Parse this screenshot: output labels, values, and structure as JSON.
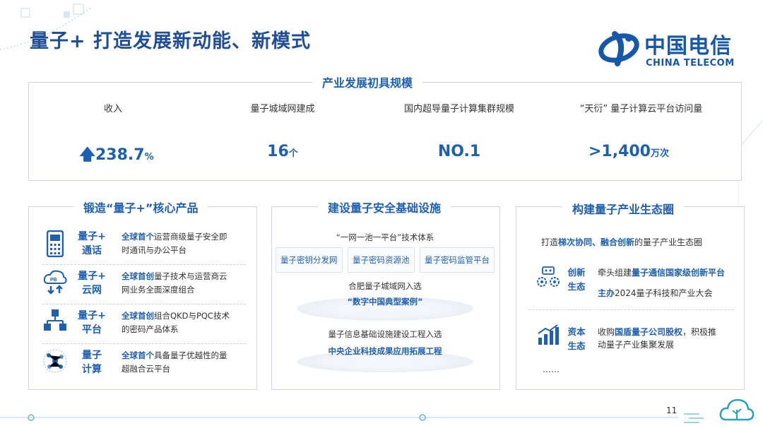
{
  "title": "量子+ 打造发展新动能、新模式",
  "logo": {
    "cn": "中国电信",
    "en": "CHINA TELECOM"
  },
  "scale": {
    "title": "产业发展初具规模",
    "stats": [
      {
        "label": "收入",
        "value": "238.7",
        "unit": "%"
      },
      {
        "label": "量子城域网建成",
        "value": "16",
        "unit": "个"
      },
      {
        "label": "国内超导量子计算集群规模",
        "value": "NO.1",
        "unit": ""
      },
      {
        "label": "“天衍” 量子计算云平台访问量",
        "value": ">1,400",
        "unit": "万次"
      }
    ]
  },
  "products": {
    "title": "锻造“量子+”核心产品",
    "items": [
      {
        "name1": "量子+",
        "name2": "通话",
        "hl": "全球首个",
        "desc1": "运营商级量子安全即",
        "desc2": "时通讯与办公平台"
      },
      {
        "name1": "量子+",
        "name2": "云网",
        "hl": "全球首创",
        "desc1": "量子技术与运营商云",
        "desc2": "网业务全面深度组合"
      },
      {
        "name1": "量子+",
        "name2": "平台",
        "hl": "全球首创",
        "desc1": "组合QKD与PQC技术",
        "desc2": "的密码产品体系"
      },
      {
        "name1": "量子",
        "name2": "计算",
        "hl": "全球首个",
        "desc1": "具备量子优越性的量",
        "desc2": "超融合云平台"
      }
    ]
  },
  "infra": {
    "title": "建设量子安全基础设施",
    "system": "“一网一池一平台”技术体系",
    "tags": [
      "量子密钥分发网",
      "量子密码资源池",
      "量子密码监管平台"
    ],
    "case1_line1": "合肥量子城域网入选",
    "case1_line2": "“数字中国典型案例”",
    "case2_line1": "量子信息基础设施建设工程入选",
    "case2_line2": "中央企业科技成果应用拓展工程"
  },
  "eco": {
    "title": "构建量子产业生态圈",
    "intro_pre": "打造",
    "intro_hl": "梯次协同、融合创新",
    "intro_post": "的量子产业生态圈",
    "items": [
      {
        "label1": "创新",
        "label2": "生态",
        "line1_pre": "牵头组建",
        "line1_hl": "量子通信国家级创新平台",
        "line2_hl": "主办",
        "line2_post": "2024量子科技和产业大会"
      },
      {
        "label1": "资本",
        "label2": "生态",
        "line1_pre": "收购",
        "line1_hl": "国盾量子公司股权",
        "line1_post": "，积极推",
        "line2_post": "动量子产业集聚发展"
      }
    ],
    "more": "……"
  },
  "page_number": "11",
  "colors": {
    "primary": "#1f5fb0",
    "title": "#1f4e96",
    "border": "#cfd6e0"
  }
}
